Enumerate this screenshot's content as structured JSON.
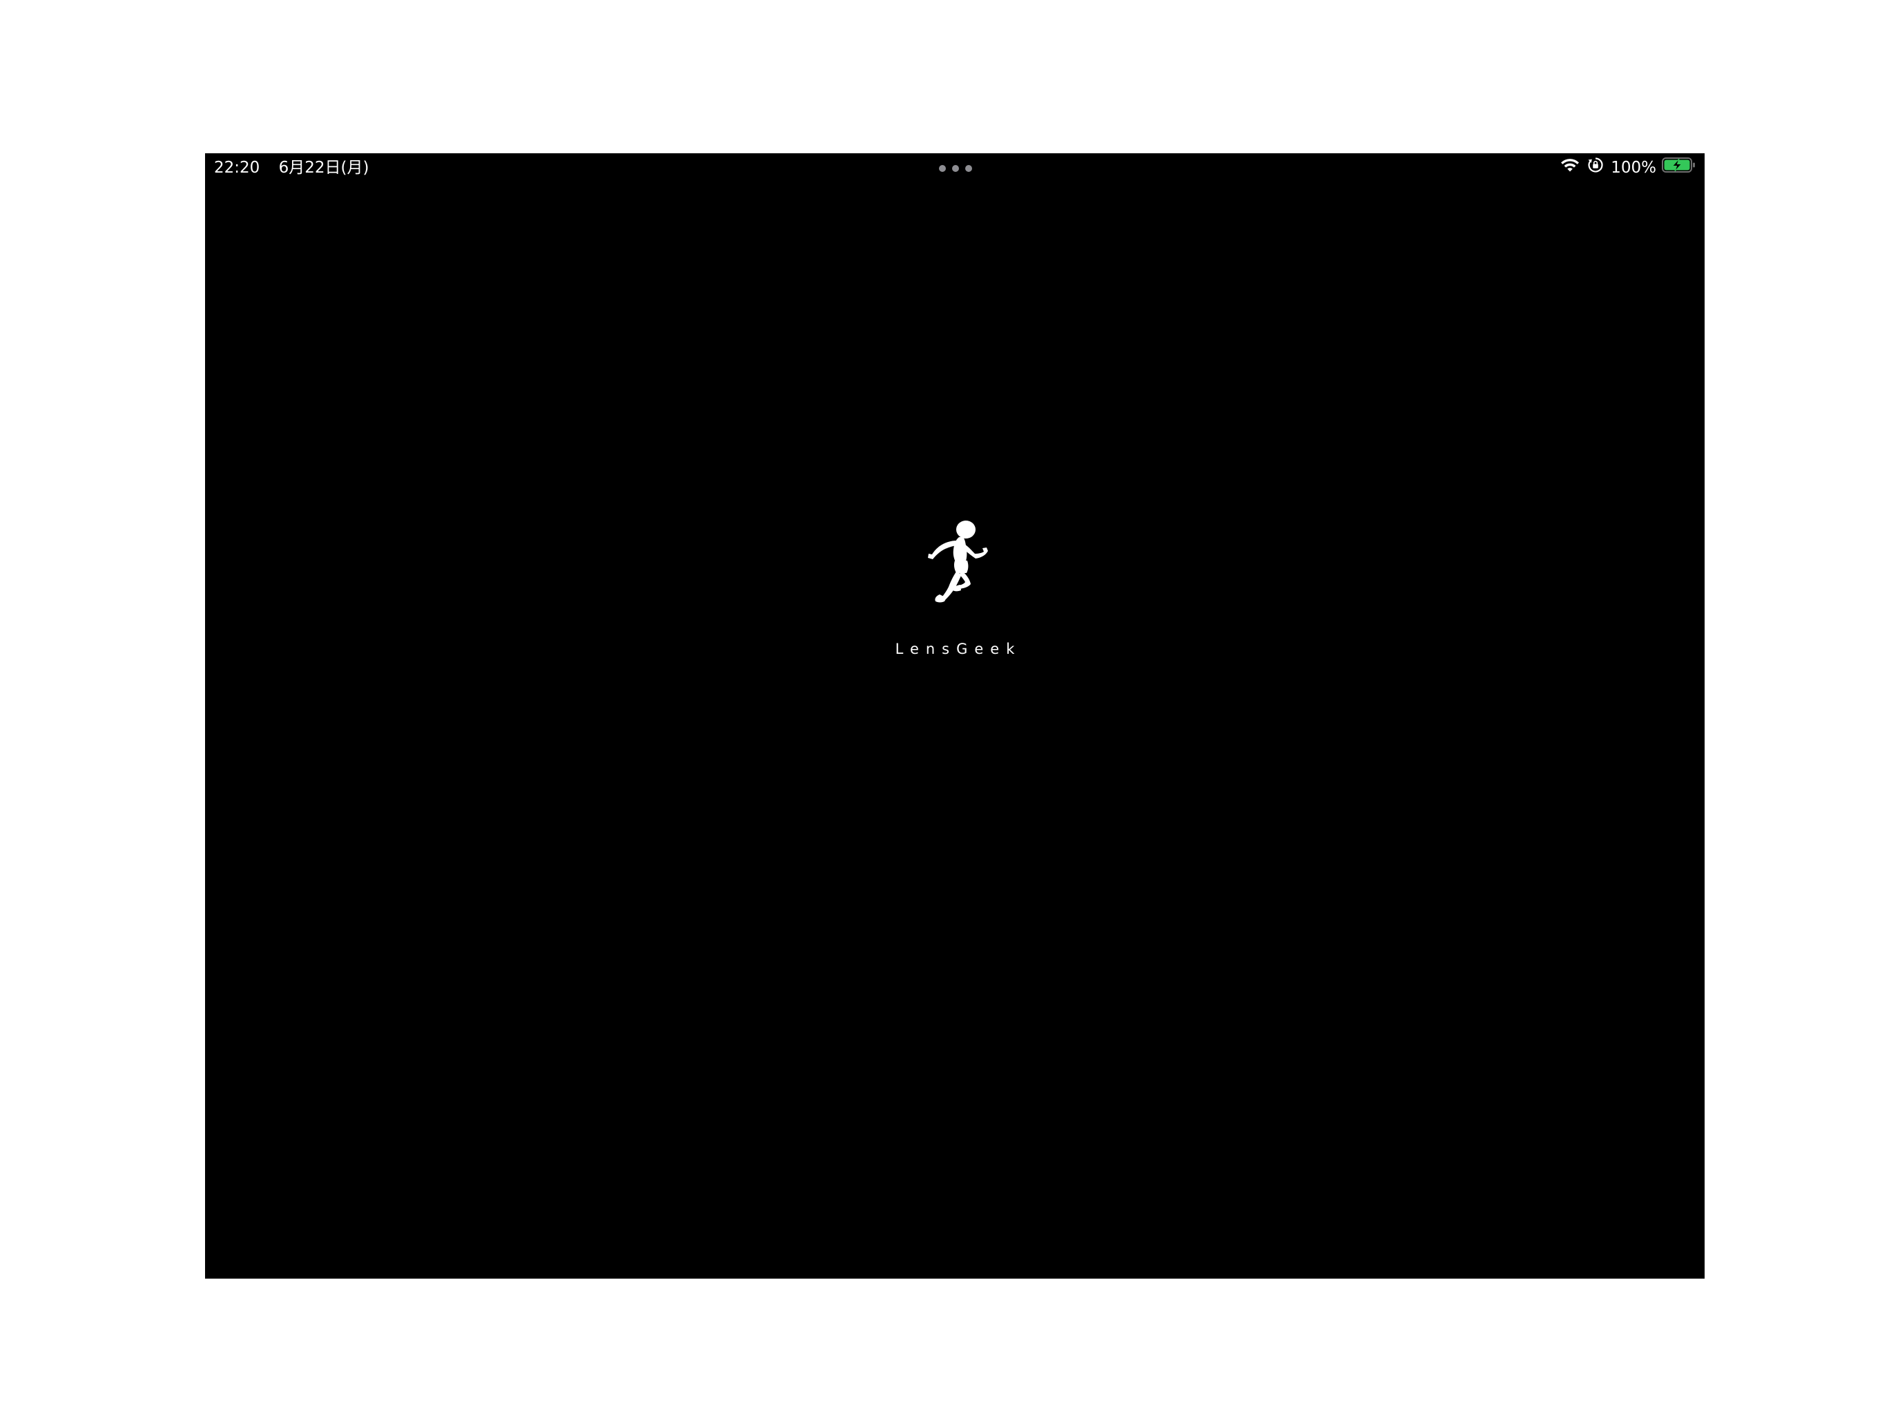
{
  "status_bar": {
    "time": "22:20",
    "date": "6月22日(月)",
    "battery_percent": "100%",
    "battery_level": 1.0,
    "battery_charging": true,
    "battery_color": "#34c759",
    "icons": [
      "wifi-icon",
      "orientation-lock-icon",
      "battery-charging-icon"
    ]
  },
  "splash": {
    "app_name": "LensGeek",
    "logo_icon": "running-child-silhouette-icon"
  },
  "colors": {
    "screen_background": "#000000",
    "page_background": "#ffffff",
    "text": "#ffffff",
    "dots": "#8e8e93"
  }
}
